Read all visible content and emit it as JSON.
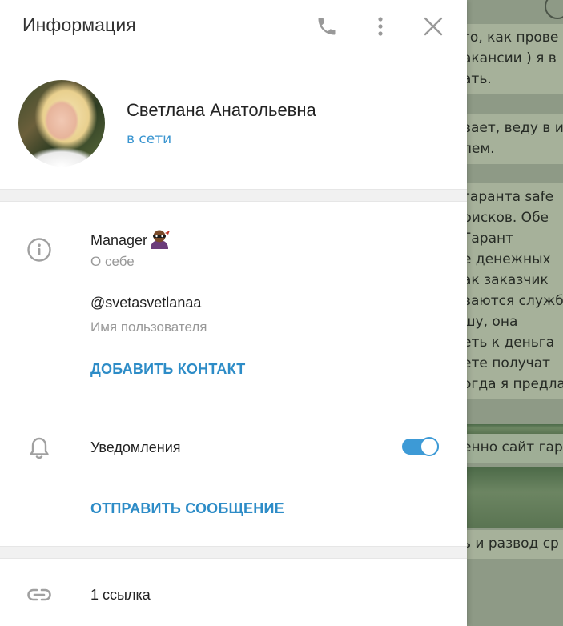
{
  "background_chat": {
    "lines": [
      [
        "го, как прове",
        "акансии ) я в",
        "ать."
      ],
      [
        "вает, веду в и",
        "лем."
      ],
      [
        "гаранта safe",
        "рисков. Обе",
        " Гарант",
        "е денежных",
        "ак заказчик",
        "ваются служба",
        "шу, она",
        "еть к деньга",
        "ете получат",
        "огда я предла"
      ],
      [
        "енно сайт гар"
      ],
      [
        "ь и развод ср"
      ]
    ]
  },
  "panel": {
    "title": "Информация",
    "icons": {
      "call": "phone-icon",
      "more": "more-vertical-icon",
      "close": "close-icon"
    },
    "profile": {
      "name": "Светлана Анатольевна",
      "status": "в сети"
    },
    "info": {
      "bio": "Manager",
      "bio_caption": "О себе",
      "username": "@svetasvetlanaa",
      "username_caption": "Имя пользователя",
      "add_contact": "ДОБАВИТЬ КОНТАКТ"
    },
    "notifications": {
      "label": "Уведомления",
      "enabled": true
    },
    "send_message": "ОТПРАВИТЬ СООБЩЕНИЕ",
    "links": {
      "label": "1 ссылка"
    }
  },
  "colors": {
    "accent": "#3d9ad6",
    "action_text": "#2d8cc7",
    "status": "#3a95d0"
  }
}
